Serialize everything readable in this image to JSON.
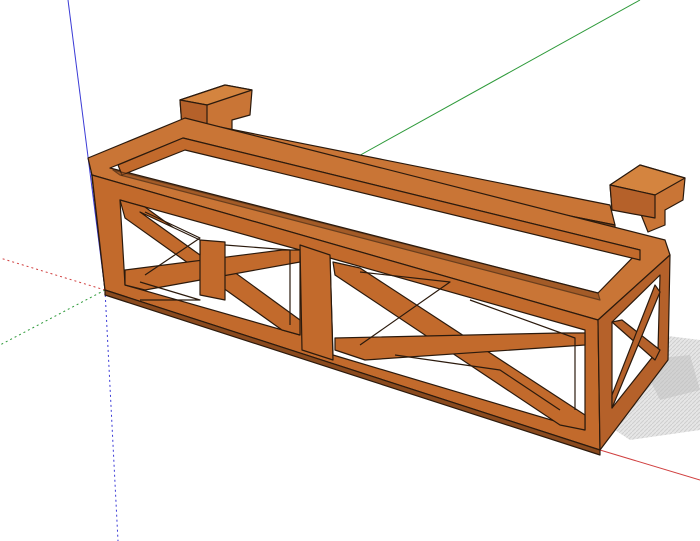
{
  "scene": {
    "background_color": "#ffffff",
    "model": "planter-box-with-rail-hooks",
    "colors": {
      "wood_front": "#c26a2c",
      "wood_side": "#b5612a",
      "wood_top": "#c97536",
      "wood_shadow": "#8a4a1e",
      "edge": "#2b1a0d",
      "liner": "#d8d8d8",
      "ground_shadow": "#d9d9d9"
    },
    "axes": {
      "red": "#d04040",
      "green": "#2e9a3a",
      "blue": "#3b3bd6"
    }
  }
}
